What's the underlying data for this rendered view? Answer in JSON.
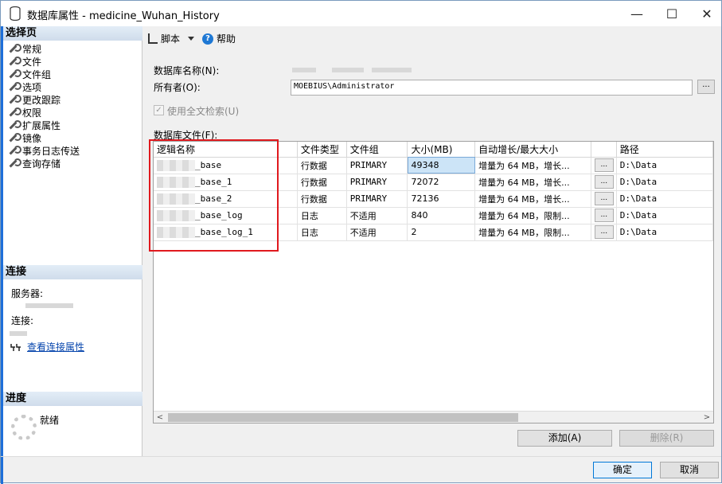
{
  "window": {
    "title": "数据库属性 - medicine_Wuhan_History",
    "min_glyph": "—",
    "max_glyph": "☐",
    "close_glyph": "✕"
  },
  "sidebar": {
    "select_page_header": "选择页",
    "pages": [
      "常规",
      "文件",
      "文件组",
      "选项",
      "更改跟踪",
      "权限",
      "扩展属性",
      "镜像",
      "事务日志传送",
      "查询存储"
    ],
    "connection_header": "连接",
    "server_label": "服务器:",
    "connection_label": "连接:",
    "view_connection_link": "查看连接属性",
    "progress_header": "进度",
    "progress_status": "就绪"
  },
  "toolbar": {
    "script_label": "脚本",
    "help_label": "帮助"
  },
  "form": {
    "db_name_label": "数据库名称(N):",
    "owner_label": "所有者(O):",
    "owner_value": "MOEBIUS\\Administrator",
    "browse_label": "...",
    "fulltext_label": "使用全文检索(U)",
    "files_label": "数据库文件(F):"
  },
  "files_table": {
    "columns": [
      "逻辑名称",
      "文件类型",
      "文件组",
      "大小(MB)",
      "自动增长/最大大小",
      "",
      "路径"
    ],
    "rows": [
      {
        "name_suffix": "_base",
        "type": "行数据",
        "filegroup": "PRIMARY",
        "size": "49348",
        "growth": "增量为 64 MB，增长...",
        "btn": "...",
        "path": "D:\\Data"
      },
      {
        "name_suffix": "_base_1",
        "type": "行数据",
        "filegroup": "PRIMARY",
        "size": "72072",
        "growth": "增量为 64 MB，增长...",
        "btn": "...",
        "path": "D:\\Data"
      },
      {
        "name_suffix": "_base_2",
        "type": "行数据",
        "filegroup": "PRIMARY",
        "size": "72136",
        "growth": "增量为 64 MB，增长...",
        "btn": "...",
        "path": "D:\\Data"
      },
      {
        "name_suffix": "_base_log",
        "type": "日志",
        "filegroup": "不适用",
        "size": "840",
        "growth": "增量为 64 MB，限制...",
        "btn": "...",
        "path": "D:\\Data"
      },
      {
        "name_suffix": "_base_log_1",
        "type": "日志",
        "filegroup": "不适用",
        "size": "2",
        "growth": "增量为 64 MB，限制...",
        "btn": "...",
        "path": "D:\\Data"
      }
    ]
  },
  "buttons": {
    "add": "添加(A)",
    "remove": "删除(R)",
    "ok": "确定",
    "cancel": "取消"
  },
  "scroll": {
    "left": "<",
    "right": ">"
  },
  "colors": {
    "highlight_box": "#e0191e",
    "accent": "#1e6fd9"
  }
}
